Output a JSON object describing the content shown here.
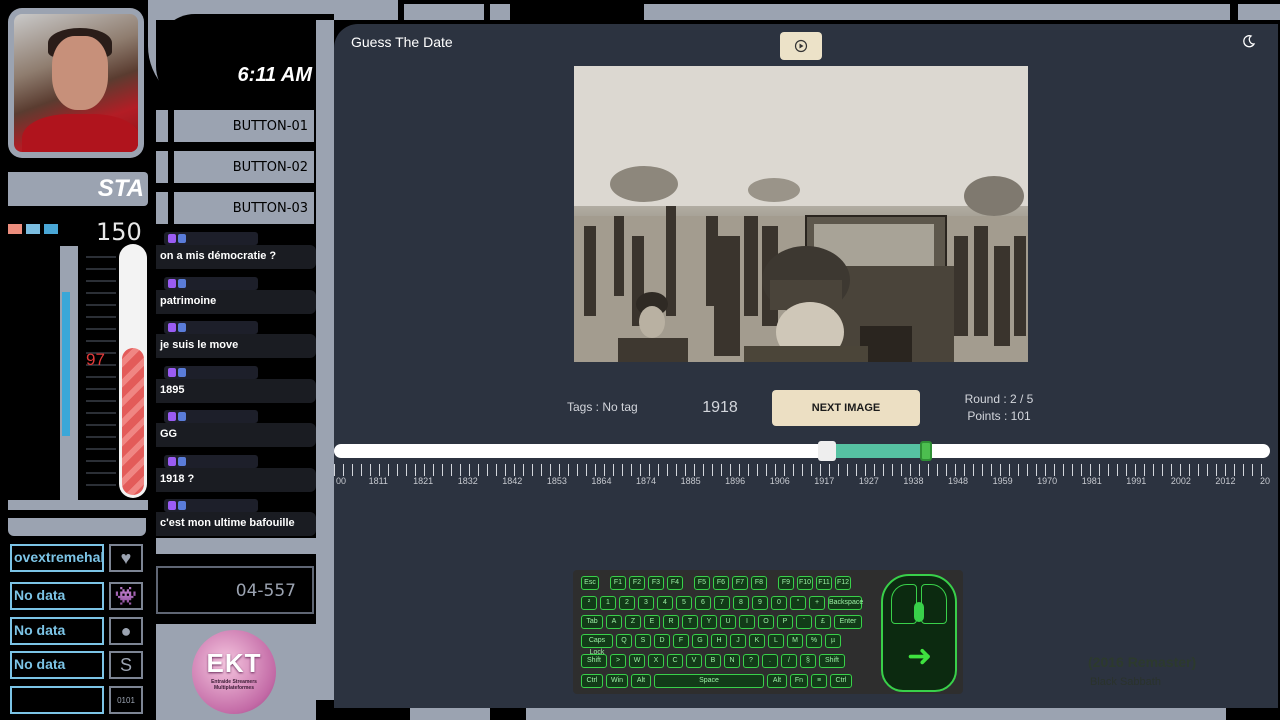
{
  "overlay": {
    "star_label": "STA",
    "gauge_value": "150",
    "thermo_value": "97",
    "thermo_percent": 58,
    "clock": "6:11 AM",
    "buttons": [
      "BUTTON-01",
      "BUTTON-02",
      "BUTTON-03"
    ],
    "code": "04-557",
    "stats": [
      {
        "label": "ovextremehal",
        "icon": "heart-icon",
        "glyph": "♥"
      },
      {
        "label": "No data",
        "icon": "invader-icon",
        "glyph": "👾"
      },
      {
        "label": "No data",
        "icon": "coin-icon",
        "glyph": "●"
      },
      {
        "label": "No data",
        "icon": "s-icon",
        "glyph": "S"
      },
      {
        "label": "",
        "icon": "binary-icon",
        "glyph": "0101"
      }
    ],
    "logo": {
      "name": "EKT",
      "tagline": "Entraide Streamers Multiplateformes"
    },
    "chat": [
      {
        "user": "",
        "text": "on a mis démocratie ?"
      },
      {
        "user": "",
        "text": "patrimoine"
      },
      {
        "user": "",
        "text": "je suis le move"
      },
      {
        "user": "",
        "text": "1895"
      },
      {
        "user": "",
        "text": "GG"
      },
      {
        "user": "",
        "text": "1918 ?"
      },
      {
        "user": "",
        "text": "c'est mon ultime bafouille"
      }
    ],
    "now_playing": {
      "song": "(2016 Remaster)",
      "artist": "Black Sabbath"
    }
  },
  "app": {
    "title": "Guess The Date",
    "tags": "Tags : No tag",
    "year_value": "1918",
    "next_label": "NEXT IMAGE",
    "round": "Round : 2 / 5",
    "points": "Points : 101",
    "slider_range": [
      1900,
      1918
    ],
    "ticks": [
      "00",
      "1811",
      "1821",
      "1832",
      "1842",
      "1853",
      "1864",
      "1874",
      "1885",
      "1896",
      "1906",
      "1917",
      "1927",
      "1938",
      "1948",
      "1959",
      "1970",
      "1981",
      "1991",
      "2002",
      "2012",
      "20"
    ]
  },
  "keyboard": {
    "rows": [
      [
        "Esc",
        "F1",
        "F2",
        "F3",
        "F4",
        "F5",
        "F6",
        "F7",
        "F8",
        "F9",
        "F10",
        "F11",
        "F12"
      ],
      [
        "²",
        "1",
        "2",
        "3",
        "4",
        "5",
        "6",
        "7",
        "8",
        "9",
        "0",
        "°",
        "+",
        "Backspace"
      ],
      [
        "Tab",
        "A",
        "Z",
        "E",
        "R",
        "T",
        "Y",
        "U",
        "I",
        "O",
        "P",
        "¨",
        "£",
        "Enter"
      ],
      [
        "Caps Lock",
        "Q",
        "S",
        "D",
        "F",
        "G",
        "H",
        "J",
        "K",
        "L",
        "M",
        "%",
        "µ"
      ],
      [
        "Shift",
        ">",
        "W",
        "X",
        "C",
        "V",
        "B",
        "N",
        "?",
        ".",
        "/",
        "§",
        "Shift"
      ],
      [
        "Ctrl",
        "Win",
        "Alt",
        "Space",
        "Alt",
        "Fn",
        "≡",
        "Ctrl"
      ]
    ]
  }
}
